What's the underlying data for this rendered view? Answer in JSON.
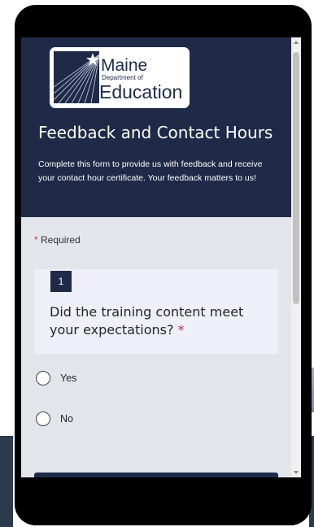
{
  "logo": {
    "line1": "Maine",
    "line2": "Department of",
    "line3": "Education"
  },
  "form": {
    "title": "Feedback and Contact Hours",
    "description": "Complete this form to provide us with feedback and receive your contact hour certificate.  Your feedback matters to us!",
    "required_star": "*",
    "required_label": " Required"
  },
  "question": {
    "number": "1",
    "text": "Did the training content meet your expectations? ",
    "required_star": "*",
    "options": [
      "Yes",
      "No"
    ]
  },
  "colors": {
    "header_bg": "#1e2a47",
    "body_bg": "#e4e5ea",
    "card_bg": "#eeeff8",
    "required_red": "#c4314b"
  }
}
